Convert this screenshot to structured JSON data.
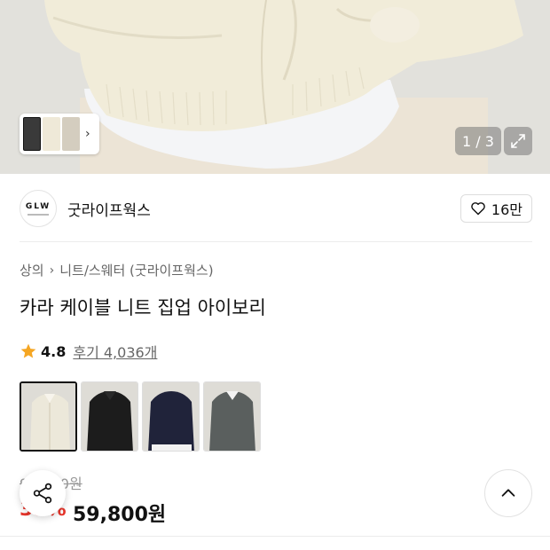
{
  "gallery": {
    "counter": "1 / 3",
    "thumb_colors": [
      "#efeadb",
      "#d9d3c8",
      "#c9c2b4"
    ]
  },
  "brand": {
    "logo_text": "GLW",
    "name": "굿라이프웍스",
    "likes": "16만"
  },
  "breadcrumb": {
    "level1": "상의",
    "level2": "니트/스웨터 (굿라이프웍스)"
  },
  "product": {
    "title": "카라 케이블 니트 집업 아이보리",
    "rating": "4.8",
    "reviews": "후기 4,036개"
  },
  "color_options": [
    {
      "name": "ivory",
      "color": "#ece8da"
    },
    {
      "name": "black",
      "color": "#1c1c1c"
    },
    {
      "name": "navy",
      "color": "#20233a"
    },
    {
      "name": "gray",
      "color": "#5a5f5e"
    }
  ],
  "price": {
    "original": "99,000원",
    "discount": "39%",
    "sale": "59,800원"
  },
  "colors": {
    "discount_red": "#e7352b",
    "star": "#f5a623"
  }
}
